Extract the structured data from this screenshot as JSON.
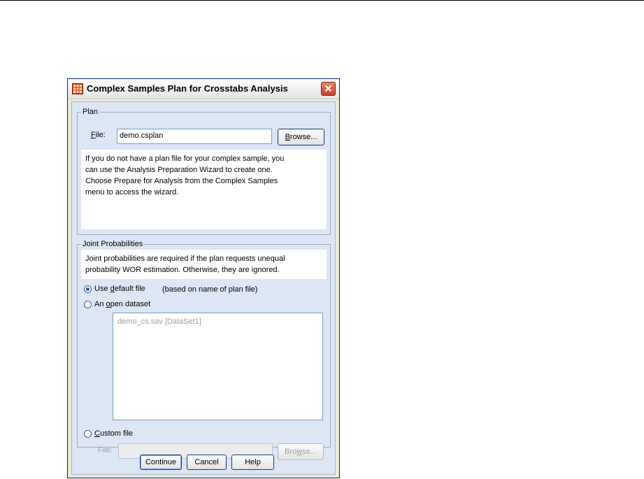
{
  "dialog": {
    "title": "Complex Samples Plan for Crosstabs Analysis"
  },
  "plan": {
    "legend": "Plan",
    "file_label_prefix": "",
    "file_label_hotkey": "F",
    "file_label_rest": "ile:",
    "file_value": "demo.csplan",
    "browse_hotkey": "B",
    "browse_rest": "rowse...",
    "info_lines": [
      "If you do not have a plan file for your complex sample, you",
      "can use the Analysis Preparation Wizard to create one.",
      "Choose Prepare for Analysis from the Complex Samples",
      "menu to access the wizard."
    ]
  },
  "joint": {
    "legend": "Joint Probabilities",
    "info_lines": [
      "Joint probabilities are required if the plan requests unequal",
      "probability WOR estimation. Otherwise, they are ignored."
    ],
    "radio_default": {
      "pre": "Use ",
      "hotkey": "d",
      "post": "efault file",
      "checked": true
    },
    "default_note": "(based on name of plan file)",
    "radio_open": {
      "pre": "An ",
      "hotkey": "o",
      "post": "pen dataset",
      "checked": false
    },
    "datasets": [
      "demo_cs.sav [DataSet1]"
    ],
    "radio_custom": {
      "pre": "",
      "hotkey": "C",
      "post": "ustom file",
      "checked": false
    },
    "custom_file_label": "File:",
    "custom_file_value": "",
    "custom_browse_hotkey": "w",
    "custom_browse_pre": "Bro",
    "custom_browse_post": "se..."
  },
  "buttons": {
    "continue": "Continue",
    "cancel": "Cancel",
    "help": "Help"
  },
  "colors": {
    "accent": "#2a5cc6",
    "close": "#c4402a"
  }
}
